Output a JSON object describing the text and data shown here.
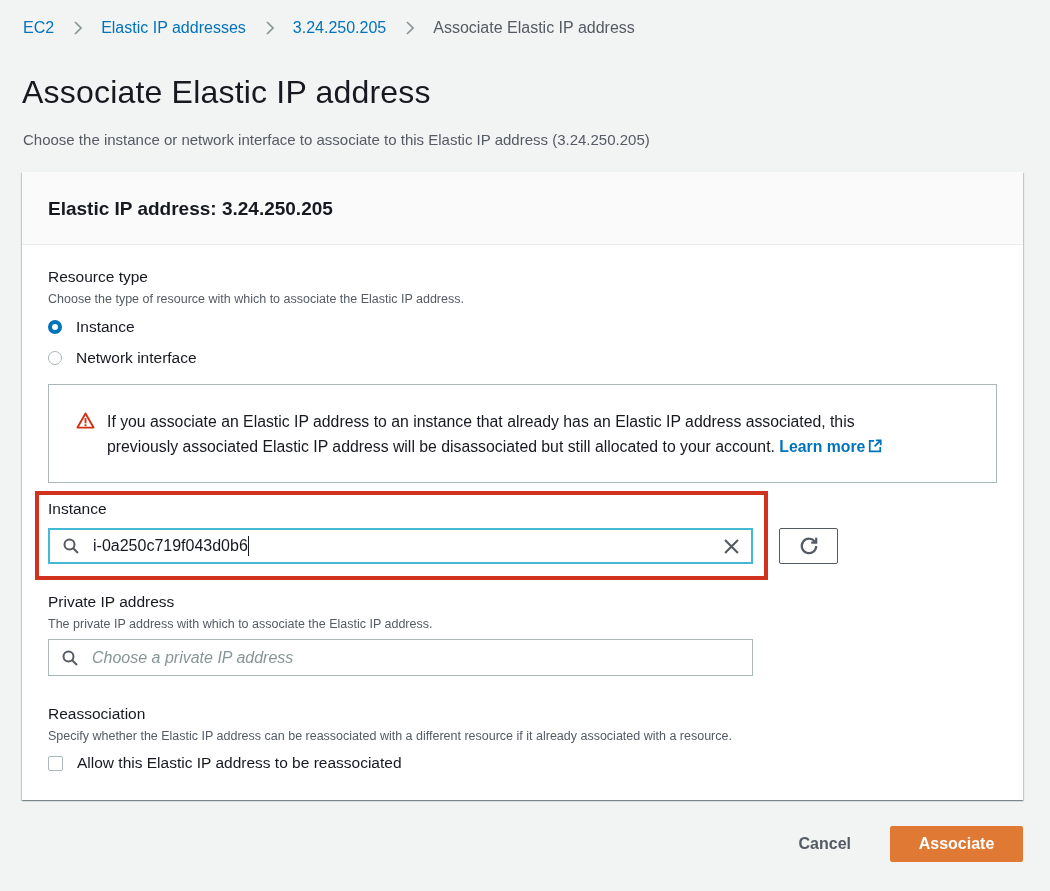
{
  "breadcrumb": [
    {
      "label": "EC2",
      "link": true
    },
    {
      "label": "Elastic IP addresses",
      "link": true
    },
    {
      "label": "3.24.250.205",
      "link": true
    },
    {
      "label": "Associate Elastic IP address",
      "link": false
    }
  ],
  "page": {
    "title": "Associate Elastic IP address",
    "description": "Choose the instance or network interface to associate to this Elastic IP address (3.24.250.205)"
  },
  "card": {
    "title": "Elastic IP address: 3.24.250.205"
  },
  "resource_type": {
    "label": "Resource type",
    "description": "Choose the type of resource with which to associate the Elastic IP address.",
    "options": [
      {
        "label": "Instance",
        "selected": true
      },
      {
        "label": "Network interface",
        "selected": false
      }
    ]
  },
  "alert": {
    "text": "If you associate an Elastic IP address to an instance that already has an Elastic IP address associated, this previously associated Elastic IP address will be disassociated but still allocated to your account.",
    "link": "Learn more"
  },
  "instance": {
    "label": "Instance",
    "value": "i-0a250c719f043d0b6",
    "focused": true,
    "highlighted": true
  },
  "private_ip": {
    "label": "Private IP address",
    "description": "The private IP address with which to associate the Elastic IP address.",
    "placeholder": "Choose a private IP address"
  },
  "reassociation": {
    "label": "Reassociation",
    "description": "Specify whether the Elastic IP address can be reassociated with a different resource if it already associated with a resource.",
    "checkbox": {
      "label": "Allow this Elastic IP address to be reassociated",
      "checked": false
    }
  },
  "actions": [
    {
      "label": "Cancel",
      "kind": "link"
    },
    {
      "label": "Associate",
      "kind": "primary"
    }
  ]
}
